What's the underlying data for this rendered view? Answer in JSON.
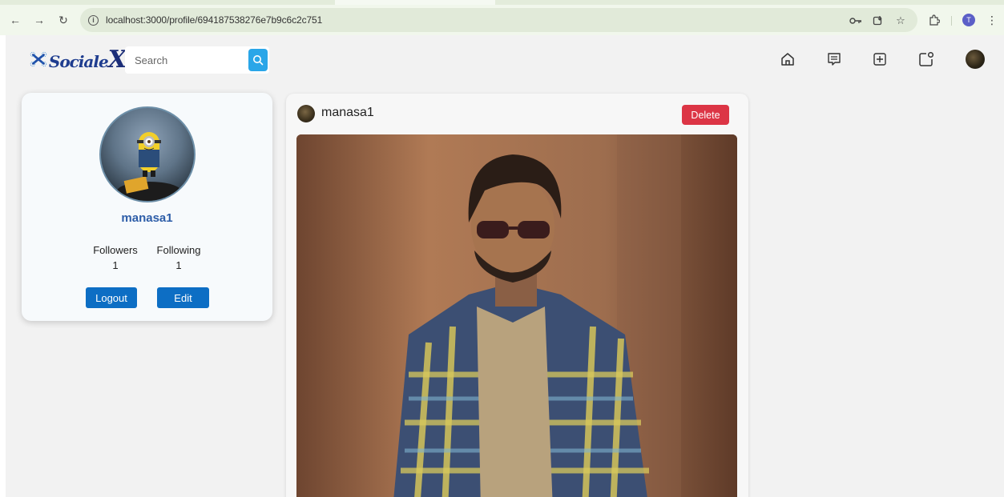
{
  "browser": {
    "url": "localhost:3000/profile/694187538276e7b9c6c2c751",
    "profile_initial": "T"
  },
  "navbar": {
    "logo_text": "Sociale",
    "logo_x": "X",
    "search_placeholder": "Search",
    "icons": [
      "home-icon",
      "chat-icon",
      "add-post-icon",
      "notifications-icon",
      "user-avatar"
    ]
  },
  "profile": {
    "username": "manasa1",
    "followers_label": "Followers",
    "followers_count": "1",
    "following_label": "Following",
    "following_count": "1",
    "logout_label": "Logout",
    "edit_label": "Edit"
  },
  "post": {
    "username": "manasa1",
    "delete_label": "Delete"
  },
  "colors": {
    "accent_blue": "#0d6ec4",
    "delete_red": "#dc3545",
    "search_blue": "#2aa6e8",
    "username_blue": "#2d5da8"
  }
}
